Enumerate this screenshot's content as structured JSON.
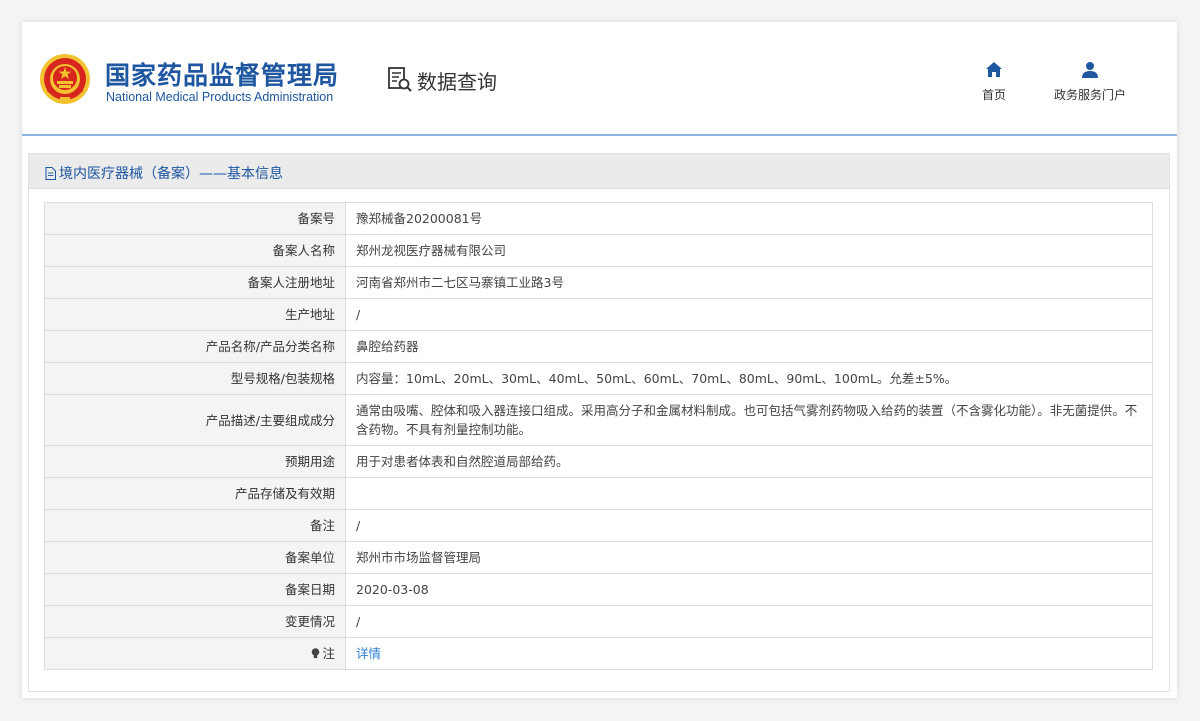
{
  "header": {
    "org_name_cn": "国家药品监督管理局",
    "org_name_en": "National Medical Products Administration",
    "query_title": "数据查询",
    "nav": {
      "home_label": "首页",
      "portal_label": "政务服务门户"
    }
  },
  "panel": {
    "title": "境内医疗器械（备案）——基本信息"
  },
  "record": {
    "rows": [
      {
        "label": "备案号",
        "value": "豫郑械备20200081号"
      },
      {
        "label": "备案人名称",
        "value": "郑州龙视医疗器械有限公司"
      },
      {
        "label": "备案人注册地址",
        "value": "河南省郑州市二七区马寨镇工业路3号"
      },
      {
        "label": "生产地址",
        "value": "/"
      },
      {
        "label": "产品名称/产品分类名称",
        "value": "鼻腔给药器"
      },
      {
        "label": "型号规格/包装规格",
        "value": "内容量：10mL、20mL、30mL、40mL、50mL、60mL、70mL、80mL、90mL、100mL。允差±5%。"
      },
      {
        "label": "产品描述/主要组成成分",
        "value": "通常由吸嘴、腔体和吸入器连接口组成。采用高分子和金属材料制成。也可包括气雾剂药物吸入给药的装置（不含雾化功能）。非无菌提供。不含药物。不具有剂量控制功能。"
      },
      {
        "label": "预期用途",
        "value": "用于对患者体表和自然腔道局部给药。"
      },
      {
        "label": "产品存储及有效期",
        "value": ""
      },
      {
        "label": "备注",
        "value": "/"
      },
      {
        "label": "备案单位",
        "value": "郑州市市场监督管理局"
      },
      {
        "label": "备案日期",
        "value": "2020-03-08"
      },
      {
        "label": "变更情况",
        "value": "/"
      }
    ],
    "note_label": "注",
    "note_link": "详情"
  },
  "colors": {
    "brand_blue": "#1e56a0",
    "link_blue": "#2e7fd6",
    "label_bg": "#f4f4f4",
    "title_bar_bg": "#ebebeb",
    "emblem_red": "#d7261e",
    "emblem_gold": "#f2c230"
  },
  "icons": {
    "emblem": "national-emblem-icon",
    "query": "data-query-icon",
    "home": "home-icon",
    "portal": "user-icon",
    "title": "document-icon",
    "note": "bulb-icon"
  }
}
